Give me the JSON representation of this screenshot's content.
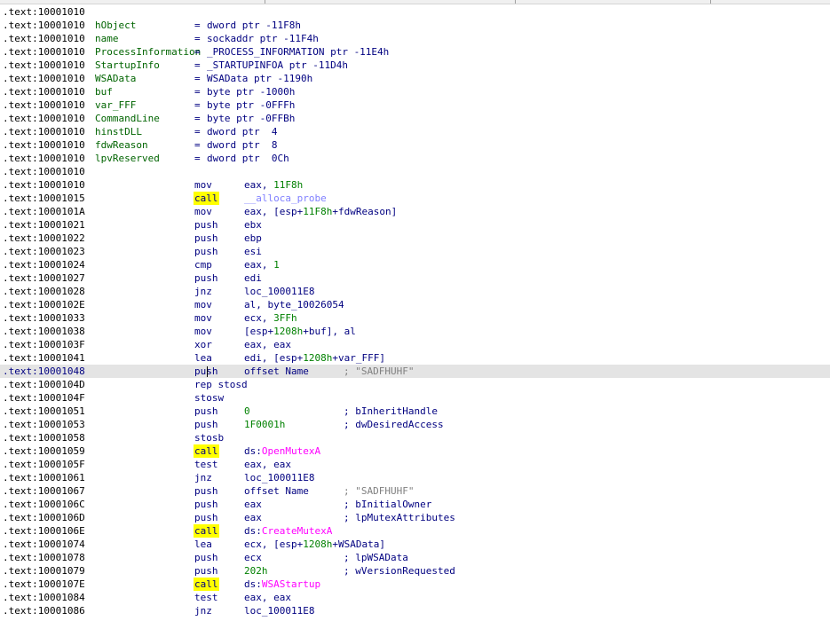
{
  "listing": {
    "lines": [
      {
        "addr": ".text:10001010"
      },
      {
        "addr": ".text:10001010",
        "var": "hObject",
        "eq": "=",
        "vtype": "dword ptr -11F8h"
      },
      {
        "addr": ".text:10001010",
        "var": "name",
        "eq": "=",
        "vtype": "sockaddr ptr -11F4h"
      },
      {
        "addr": ".text:10001010",
        "var": "ProcessInformation",
        "eq": "=",
        "vtype": "_PROCESS_INFORMATION ptr -11E4h"
      },
      {
        "addr": ".text:10001010",
        "var": "StartupInfo",
        "eq": "=",
        "vtype": "_STARTUPINFOA ptr -11D4h"
      },
      {
        "addr": ".text:10001010",
        "var": "WSAData",
        "eq": "=",
        "vtype": "WSAData ptr -1190h"
      },
      {
        "addr": ".text:10001010",
        "var": "buf",
        "eq": "=",
        "vtype": "byte ptr -1000h"
      },
      {
        "addr": ".text:10001010",
        "var": "var_FFF",
        "eq": "=",
        "vtype": "byte ptr -0FFFh"
      },
      {
        "addr": ".text:10001010",
        "var": "CommandLine",
        "eq": "=",
        "vtype": "byte ptr -0FFBh"
      },
      {
        "addr": ".text:10001010",
        "var": "hinstDLL",
        "eq": "=",
        "vtype": "dword ptr  4"
      },
      {
        "addr": ".text:10001010",
        "var": "fdwReason",
        "eq": "=",
        "vtype": "dword ptr  8"
      },
      {
        "addr": ".text:10001010",
        "var": "lpvReserved",
        "eq": "=",
        "vtype": "dword ptr  0Ch"
      },
      {
        "addr": ".text:10001010"
      },
      {
        "addr": ".text:10001010",
        "mn": "mov",
        "op": [
          {
            "t": "eax, "
          },
          {
            "t": "11F8h",
            "c": "num"
          }
        ]
      },
      {
        "addr": ".text:10001015",
        "mn": "call",
        "call": true,
        "op": [
          {
            "t": "__alloca_probe",
            "c": "func"
          }
        ]
      },
      {
        "addr": ".text:1000101A",
        "mn": "mov",
        "op": [
          {
            "t": "eax, [esp+"
          },
          {
            "t": "11F8h",
            "c": "num"
          },
          {
            "t": "+fdwReason]"
          }
        ]
      },
      {
        "addr": ".text:10001021",
        "mn": "push",
        "op": [
          {
            "t": "ebx"
          }
        ]
      },
      {
        "addr": ".text:10001022",
        "mn": "push",
        "op": [
          {
            "t": "ebp"
          }
        ]
      },
      {
        "addr": ".text:10001023",
        "mn": "push",
        "op": [
          {
            "t": "esi"
          }
        ]
      },
      {
        "addr": ".text:10001024",
        "mn": "cmp",
        "op": [
          {
            "t": "eax, "
          },
          {
            "t": "1",
            "c": "num"
          }
        ]
      },
      {
        "addr": ".text:10001027",
        "mn": "push",
        "op": [
          {
            "t": "edi"
          }
        ]
      },
      {
        "addr": ".text:10001028",
        "mn": "jnz",
        "op": [
          {
            "t": "loc_100011E8"
          }
        ]
      },
      {
        "addr": ".text:1000102E",
        "mn": "mov",
        "op": [
          {
            "t": "al, byte_10026054"
          }
        ]
      },
      {
        "addr": ".text:10001033",
        "mn": "mov",
        "op": [
          {
            "t": "ecx, "
          },
          {
            "t": "3FFh",
            "c": "num"
          }
        ]
      },
      {
        "addr": ".text:10001038",
        "mn": "mov",
        "op": [
          {
            "t": "[esp+"
          },
          {
            "t": "1208h",
            "c": "num"
          },
          {
            "t": "+buf], al"
          }
        ]
      },
      {
        "addr": ".text:1000103F",
        "mn": "xor",
        "op": [
          {
            "t": "eax, eax"
          }
        ]
      },
      {
        "addr": ".text:10001041",
        "mn": "lea",
        "op": [
          {
            "t": "edi, [esp+"
          },
          {
            "t": "1208h",
            "c": "num"
          },
          {
            "t": "+var_FFF]"
          }
        ]
      },
      {
        "addr": ".text:10001048",
        "mn": "push",
        "highlight": true,
        "caret": true,
        "op": [
          {
            "t": "offset Name"
          }
        ],
        "cmt": "; \"SADFHUHF\"",
        "cmt_str": true
      },
      {
        "addr": ".text:1000104D",
        "mn": "rep stosd"
      },
      {
        "addr": ".text:1000104F",
        "mn": "stosw"
      },
      {
        "addr": ".text:10001051",
        "mn": "push",
        "op": [
          {
            "t": "0",
            "c": "num"
          }
        ],
        "cmt": "; bInheritHandle"
      },
      {
        "addr": ".text:10001053",
        "mn": "push",
        "op": [
          {
            "t": "1F0001h",
            "c": "num"
          }
        ],
        "cmt": "; dwDesiredAccess"
      },
      {
        "addr": ".text:10001058",
        "mn": "stosb"
      },
      {
        "addr": ".text:10001059",
        "mn": "call",
        "call": true,
        "op": [
          {
            "t": "ds:"
          },
          {
            "t": "OpenMutexA",
            "c": "imp"
          }
        ]
      },
      {
        "addr": ".text:1000105F",
        "mn": "test",
        "op": [
          {
            "t": "eax, eax"
          }
        ]
      },
      {
        "addr": ".text:10001061",
        "mn": "jnz",
        "op": [
          {
            "t": "loc_100011E8"
          }
        ]
      },
      {
        "addr": ".text:10001067",
        "mn": "push",
        "op": [
          {
            "t": "offset Name"
          }
        ],
        "cmt": "; \"SADFHUHF\"",
        "cmt_str": true
      },
      {
        "addr": ".text:1000106C",
        "mn": "push",
        "op": [
          {
            "t": "eax"
          }
        ],
        "cmt": "; bInitialOwner"
      },
      {
        "addr": ".text:1000106D",
        "mn": "push",
        "op": [
          {
            "t": "eax"
          }
        ],
        "cmt": "; lpMutexAttributes"
      },
      {
        "addr": ".text:1000106E",
        "mn": "call",
        "call": true,
        "op": [
          {
            "t": "ds:"
          },
          {
            "t": "CreateMutexA",
            "c": "imp"
          }
        ]
      },
      {
        "addr": ".text:10001074",
        "mn": "lea",
        "op": [
          {
            "t": "ecx, [esp+"
          },
          {
            "t": "1208h",
            "c": "num"
          },
          {
            "t": "+WSAData]"
          }
        ]
      },
      {
        "addr": ".text:10001078",
        "mn": "push",
        "op": [
          {
            "t": "ecx"
          }
        ],
        "cmt": "; lpWSAData"
      },
      {
        "addr": ".text:10001079",
        "mn": "push",
        "op": [
          {
            "t": "202h",
            "c": "num"
          }
        ],
        "cmt": "; wVersionRequested"
      },
      {
        "addr": ".text:1000107E",
        "mn": "call",
        "call": true,
        "op": [
          {
            "t": "ds:"
          },
          {
            "t": "WSAStartup",
            "c": "imp"
          }
        ]
      },
      {
        "addr": ".text:10001084",
        "mn": "test",
        "op": [
          {
            "t": "eax, eax"
          }
        ]
      },
      {
        "addr": ".text:10001086",
        "mn": "jnz",
        "op": [
          {
            "t": "loc_100011E8"
          }
        ]
      }
    ]
  }
}
